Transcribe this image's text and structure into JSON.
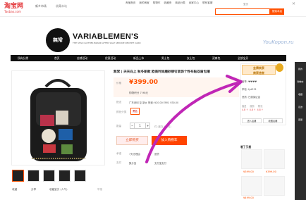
{
  "topbar": {
    "logo_main": "淘宝网",
    "logo_sub": "Taobao.com",
    "region": "新乡市场",
    "favorite": "收藏本站",
    "nav": [
      "淘宝首页",
      "我的淘宝",
      "购物车",
      "收藏夹",
      "商品分类",
      "卖家中心",
      "联系客服"
    ],
    "tab": "宝贝",
    "search_placeholder": "",
    "search_button": "搜索本店"
  },
  "brand": {
    "logo_text": "無常",
    "name": "VARIABLEMEN'S",
    "tagline": "THE STAR CLOTHES BRAND AFTER SALE SERVICE RECEIPT CARD",
    "watermark": "YouKopon.ru"
  },
  "navbar": {
    "items": [
      "所有分类",
      "首页",
      "店铺活动",
      "优惠活动",
      "新品上市",
      "男士包",
      "女士包",
      "双肩包",
      "全部宝贝"
    ]
  },
  "gallery": {
    "actions": {
      "favorite": "收藏",
      "share": "分享",
      "qr": "收藏宝贝 (人气)",
      "report": "举报"
    }
  },
  "product": {
    "title": "無常 | 天天向上 秋冬新款 欧美时尚磨砂铆钉装饰个性布贴双肩包潮",
    "price_label": "价格",
    "price": "¥399.00",
    "promo": "购物积分 7.98元",
    "ship_label": "配送",
    "ship": "广东深圳 至 新乡 快递: ¥20.00 EMS: ¥30.00",
    "color_label": "颜色分类",
    "color": "黑色",
    "qty_label": "数量",
    "qty": "1",
    "stock": "件 (库存 99 件)",
    "buy_now": "立即购买",
    "add_to_cart": "加入购物车",
    "service_label": "承诺",
    "service_items": [
      "7天无理由",
      "退货"
    ],
    "pay_label": "支付",
    "pay_items": [
      "集分宝",
      "支付宝支付"
    ]
  },
  "shop": {
    "badge_line1": "金牌卖家",
    "badge_line2": "商家信誉",
    "lines": [
      "信誉: ♥♥♥♥",
      "掌柜: fyd331",
      "资质: 已缴保证金"
    ],
    "score_labels": [
      "描述",
      "服务",
      "物流"
    ],
    "score_values": [
      "4.8 ↑",
      "4.8 ↑",
      "4.8 ↑"
    ],
    "btn_enter": "进入店铺",
    "btn_fav": "收藏店铺"
  },
  "recommend": {
    "title": "看了又看",
    "prices": [
      "¥399.00",
      "¥399.00",
      "¥499.00"
    ]
  },
  "side_rail": {
    "items": [
      "我的",
      "购物车",
      "收藏",
      "足迹",
      "客服"
    ]
  },
  "colors": {
    "accent": "#ff5000",
    "brand_red": "#e4393c",
    "nav_bg": "#111111",
    "arrow": "#c026b6"
  }
}
